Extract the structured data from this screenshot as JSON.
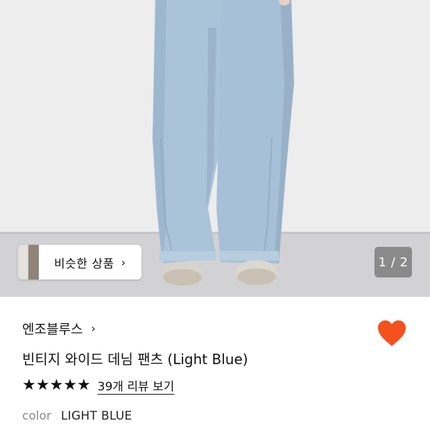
{
  "hero": {
    "similar_products_label": "비슷한 상품",
    "similar_products_chevron": "›",
    "page_counter": "1 / 2"
  },
  "product": {
    "brand": "엔조블루스",
    "brand_chevron": "›",
    "title": "빈티지 와이드 데님 팬츠 (Light Blue)",
    "rating_stars": 5,
    "review_link": "39개 리뷰 보기",
    "color_label": "color",
    "color_value": "LIGHT BLUE"
  },
  "colors": {
    "heart": "#F4511E",
    "denim": "#a9c3da",
    "background": "#ececee",
    "floor": "#cfcfd1"
  }
}
